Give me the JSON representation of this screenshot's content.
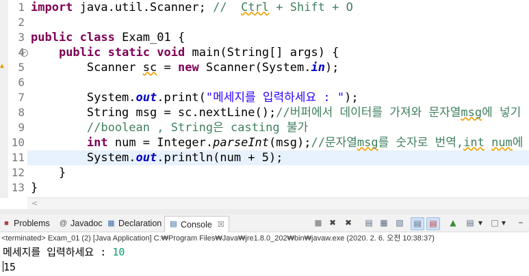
{
  "editor": {
    "line_numbers": [
      "1",
      "2",
      "3",
      "4",
      "5",
      "6",
      "7",
      "8",
      "9",
      "10",
      "11",
      "12",
      "13"
    ],
    "folded_marker_line": "4",
    "lines": [
      [
        {
          "c": "kw",
          "t": "import"
        },
        {
          "c": "var",
          "t": " java.util.Scanner; "
        },
        {
          "c": "cm",
          "t": "//  "
        },
        {
          "c": "cm squig",
          "t": "Ctrl"
        },
        {
          "c": "cm",
          "t": " + Shift + O"
        }
      ],
      [],
      [
        {
          "c": "kw",
          "t": "public"
        },
        {
          "c": "var",
          "t": " "
        },
        {
          "c": "kw",
          "t": "class"
        },
        {
          "c": "var",
          "t": " Exam_01 {"
        }
      ],
      [
        {
          "c": "var",
          "t": "    "
        },
        {
          "c": "kw",
          "t": "public"
        },
        {
          "c": "var",
          "t": " "
        },
        {
          "c": "kw",
          "t": "static"
        },
        {
          "c": "var",
          "t": " "
        },
        {
          "c": "kw",
          "t": "void"
        },
        {
          "c": "var",
          "t": " main(String[] args) {"
        }
      ],
      [
        {
          "c": "var",
          "t": "        Scanner "
        },
        {
          "c": "squig",
          "t": "sc"
        },
        {
          "c": "var",
          "t": " = "
        },
        {
          "c": "kw",
          "t": "new"
        },
        {
          "c": "var",
          "t": " Scanner(System."
        },
        {
          "c": "fld",
          "t": "in"
        },
        {
          "c": "var",
          "t": ");"
        }
      ],
      [],
      [
        {
          "c": "var",
          "t": "        System."
        },
        {
          "c": "fld",
          "t": "out"
        },
        {
          "c": "var",
          "t": ".print("
        },
        {
          "c": "str",
          "t": "\"메세지를 입력하세요 : \""
        },
        {
          "c": "var",
          "t": ");"
        }
      ],
      [
        {
          "c": "var",
          "t": "        String msg = sc.nextLine();"
        },
        {
          "c": "cm",
          "t": "//버퍼에서 데이터를 가져와 문자열"
        },
        {
          "c": "cm squig",
          "t": "msg"
        },
        {
          "c": "cm",
          "t": "에 넣기"
        }
      ],
      [
        {
          "c": "var",
          "t": "        "
        },
        {
          "c": "cm",
          "t": "//boolean , String은 casting 불가"
        }
      ],
      [
        {
          "c": "var",
          "t": "        "
        },
        {
          "c": "kw",
          "t": "int"
        },
        {
          "c": "var",
          "t": " num = Integer."
        },
        {
          "c": "it",
          "t": "parseInt"
        },
        {
          "c": "var",
          "t": "(msg);"
        },
        {
          "c": "cm",
          "t": "//문자열"
        },
        {
          "c": "cm squig",
          "t": "msg"
        },
        {
          "c": "cm",
          "t": "를 숫자로 번역,"
        },
        {
          "c": "cm squig",
          "t": "int"
        },
        {
          "c": "cm",
          "t": " "
        },
        {
          "c": "cm squig",
          "t": "num"
        },
        {
          "c": "cm",
          "t": "에 넣기"
        }
      ],
      [
        {
          "c": "var",
          "t": "        System."
        },
        {
          "c": "fld",
          "t": "out"
        },
        {
          "c": "var",
          "t": ".println(num + 5);"
        }
      ],
      [
        {
          "c": "var",
          "t": "    }"
        }
      ],
      [
        {
          "c": "var",
          "t": "}"
        }
      ]
    ]
  },
  "panel": {
    "tabs": [
      {
        "label": "Problems",
        "icon": "problems-icon"
      },
      {
        "label": "Javadoc",
        "icon": "javadoc-icon"
      },
      {
        "label": "Declaration",
        "icon": "declaration-icon"
      },
      {
        "label": "Console",
        "icon": "console-icon",
        "active": true
      }
    ],
    "close_glyph": "☒",
    "status": "<terminated> Exam_01 (2) [Java Application] C:₩Program Files₩Java₩jre1.8.0_202₩bin₩javaw.exe (2020. 2. 6. 오전 10:38:37)"
  },
  "console": {
    "prompt": "메세지를 입력하세요 : ",
    "input": "10",
    "output": "15"
  },
  "colors": {
    "keyword": "#7f0055",
    "string": "#2a00ff",
    "comment": "#3f7f5f",
    "field": "#0000c0",
    "console_input": "#00a06a"
  }
}
